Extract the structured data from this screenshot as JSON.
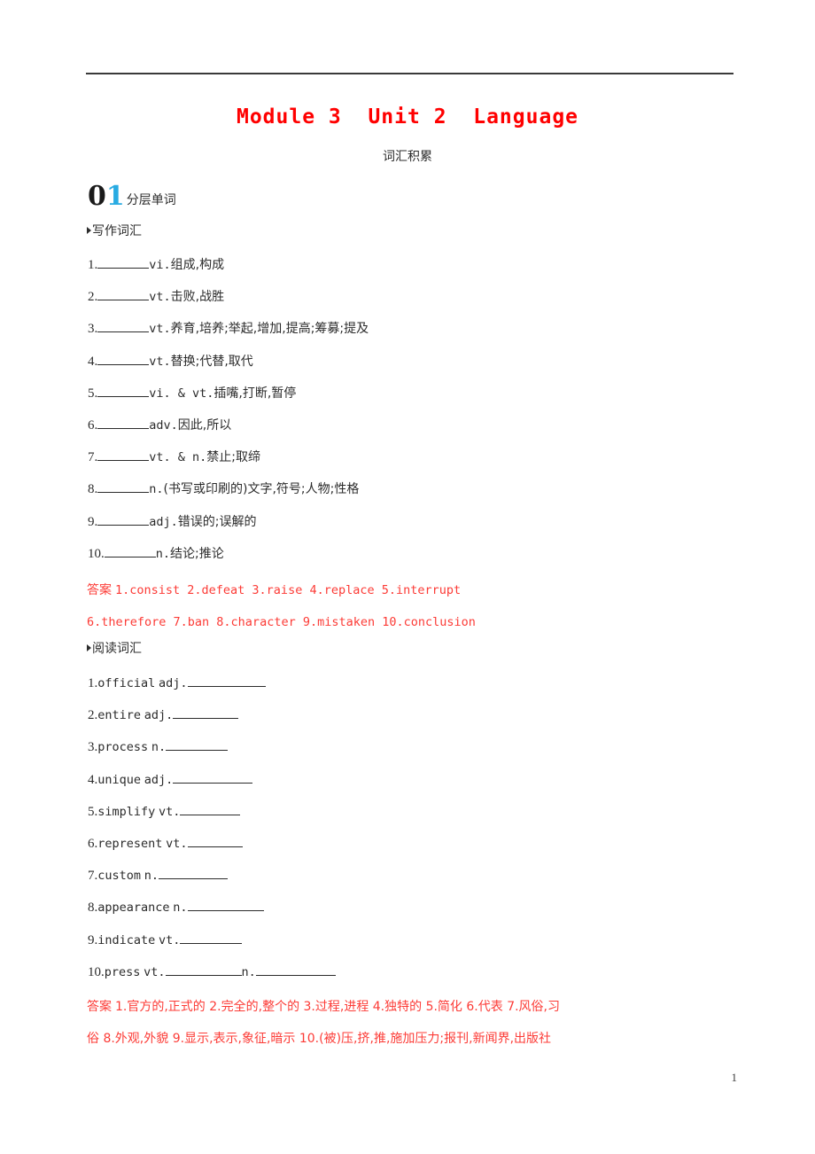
{
  "document": {
    "title": "Module 3  Unit 2  Language",
    "subtitle": "词汇积累",
    "page_number": "1",
    "title_color": "#ff0000",
    "answer_color": "#fc3b36",
    "badge_accent_color": "#29abe2"
  },
  "section": {
    "badge_zero": "0",
    "badge_one": "1",
    "badge_label": "分层单词"
  },
  "writing": {
    "heading": "写作词汇",
    "items": [
      {
        "index": "1.",
        "pos": "vi.",
        "meaning": "组成,构成"
      },
      {
        "index": "2.",
        "pos": "vt.",
        "meaning": "击败,战胜"
      },
      {
        "index": "3.",
        "pos": "vt.",
        "meaning": "养育,培养;举起,增加,提高;筹募;提及"
      },
      {
        "index": "4.",
        "pos": "vt.",
        "meaning": "替换;代替,取代"
      },
      {
        "index": "5.",
        "pos": "vi. & vt.",
        "meaning": "插嘴,打断,暂停"
      },
      {
        "index": "6.",
        "pos": "adv.",
        "meaning": "因此,所以"
      },
      {
        "index": "7.",
        "pos": "vt. & n.",
        "meaning": "禁止;取缔"
      },
      {
        "index": "8.",
        "pos": "n.",
        "meaning": "(书写或印刷的)文字,符号;人物;性格"
      },
      {
        "index": "9.",
        "pos": "adj.",
        "meaning": "错误的;误解的"
      },
      {
        "index": "10.",
        "pos": "n.",
        "meaning": "结论;推论"
      }
    ],
    "answers_label": "答案",
    "answers_line1": "1.consist  2.defeat  3.raise  4.replace  5.interrupt",
    "answers_line2": "6.therefore  7.ban  8.character  9.mistaken  10.conclusion"
  },
  "reading": {
    "heading": "阅读词汇",
    "items": [
      {
        "index": "1.",
        "word": "official",
        "pos": "adj.",
        "blank_width": 88,
        "pos2": "",
        "blank2_width": 0
      },
      {
        "index": "2.",
        "word": "entire",
        "pos": "adj.",
        "blank_width": 74,
        "pos2": "",
        "blank2_width": 0
      },
      {
        "index": "3.",
        "word": "process",
        "pos": "n.",
        "blank_width": 70,
        "pos2": "",
        "blank2_width": 0
      },
      {
        "index": "4.",
        "word": "unique",
        "pos": "adj.",
        "blank_width": 90,
        "pos2": "",
        "blank2_width": 0
      },
      {
        "index": "5.",
        "word": "simplify",
        "pos": "vt.",
        "blank_width": 68,
        "pos2": "",
        "blank2_width": 0
      },
      {
        "index": "6.",
        "word": "represent",
        "pos": "vt.",
        "blank_width": 62,
        "pos2": "",
        "blank2_width": 0
      },
      {
        "index": "7.",
        "word": "custom",
        "pos": "n.",
        "blank_width": 78,
        "pos2": "",
        "blank2_width": 0
      },
      {
        "index": "8.",
        "word": "appearance",
        "pos": "n.",
        "blank_width": 86,
        "pos2": "",
        "blank2_width": 0
      },
      {
        "index": "9.",
        "word": "indicate",
        "pos": "vt.",
        "blank_width": 70,
        "pos2": "",
        "blank2_width": 0
      },
      {
        "index": "10.",
        "word": "press",
        "pos": "vt.",
        "blank_width": 86,
        "pos2": "n.",
        "blank2_width": 90
      }
    ],
    "answers_label": "答案",
    "answers_line1": "1.官方的,正式的  2.完全的,整个的  3.过程,进程  4.独特的  5.简化  6.代表  7.风俗,习",
    "answers_line2": "俗  8.外观,外貌    9.显示,表示,象征,暗示  10.(被)压,挤,推,施加压力;报刊,新闻界,出版社"
  }
}
